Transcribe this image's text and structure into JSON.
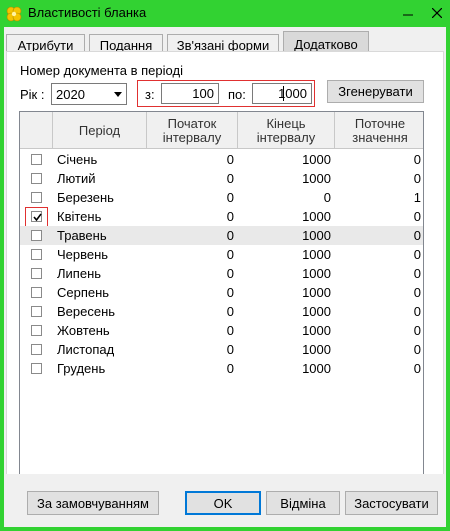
{
  "window": {
    "title": "Властивості бланка",
    "icon": "yellow-flower-icon",
    "accent": "#32d232"
  },
  "tabs": [
    {
      "label": "Атрибути",
      "active": false
    },
    {
      "label": "Подання",
      "active": false
    },
    {
      "label": "Зв'язані форми",
      "active": false
    },
    {
      "label": "Додатково",
      "active": true
    }
  ],
  "range": {
    "group_label": "Номер документа в періоді",
    "year_label": "Рік :",
    "year_value": "2020",
    "from_label": "з:",
    "from_value": "100",
    "to_label": "по:",
    "to_value": "1000",
    "generate_label": "Згенерувати"
  },
  "table": {
    "headers": [
      "Період",
      "Початок інтервалу",
      "Кінець інтервалу",
      "Поточне значення"
    ],
    "rows": [
      {
        "checked": false,
        "period": "Січень",
        "start": "0",
        "end": "1000",
        "current": "0"
      },
      {
        "checked": false,
        "period": "Лютий",
        "start": "0",
        "end": "1000",
        "current": "0"
      },
      {
        "checked": false,
        "period": "Березень",
        "start": "0",
        "end": "0",
        "current": "1"
      },
      {
        "checked": true,
        "period": "Квітень",
        "start": "0",
        "end": "1000",
        "current": "0"
      },
      {
        "checked": false,
        "period": "Травень",
        "start": "0",
        "end": "1000",
        "current": "0"
      },
      {
        "checked": false,
        "period": "Червень",
        "start": "0",
        "end": "1000",
        "current": "0"
      },
      {
        "checked": false,
        "period": "Липень",
        "start": "0",
        "end": "1000",
        "current": "0"
      },
      {
        "checked": false,
        "period": "Серпень",
        "start": "0",
        "end": "1000",
        "current": "0"
      },
      {
        "checked": false,
        "period": "Вересень",
        "start": "0",
        "end": "1000",
        "current": "0"
      },
      {
        "checked": false,
        "period": "Жовтень",
        "start": "0",
        "end": "1000",
        "current": "0"
      },
      {
        "checked": false,
        "period": "Листопад",
        "start": "0",
        "end": "1000",
        "current": "0"
      },
      {
        "checked": false,
        "period": "Грудень",
        "start": "0",
        "end": "1000",
        "current": "0"
      }
    ]
  },
  "footer": {
    "defaults_label": "За замовчуванням",
    "ok_label": "OK",
    "cancel_label": "Відміна",
    "apply_label": "Застосувати"
  }
}
